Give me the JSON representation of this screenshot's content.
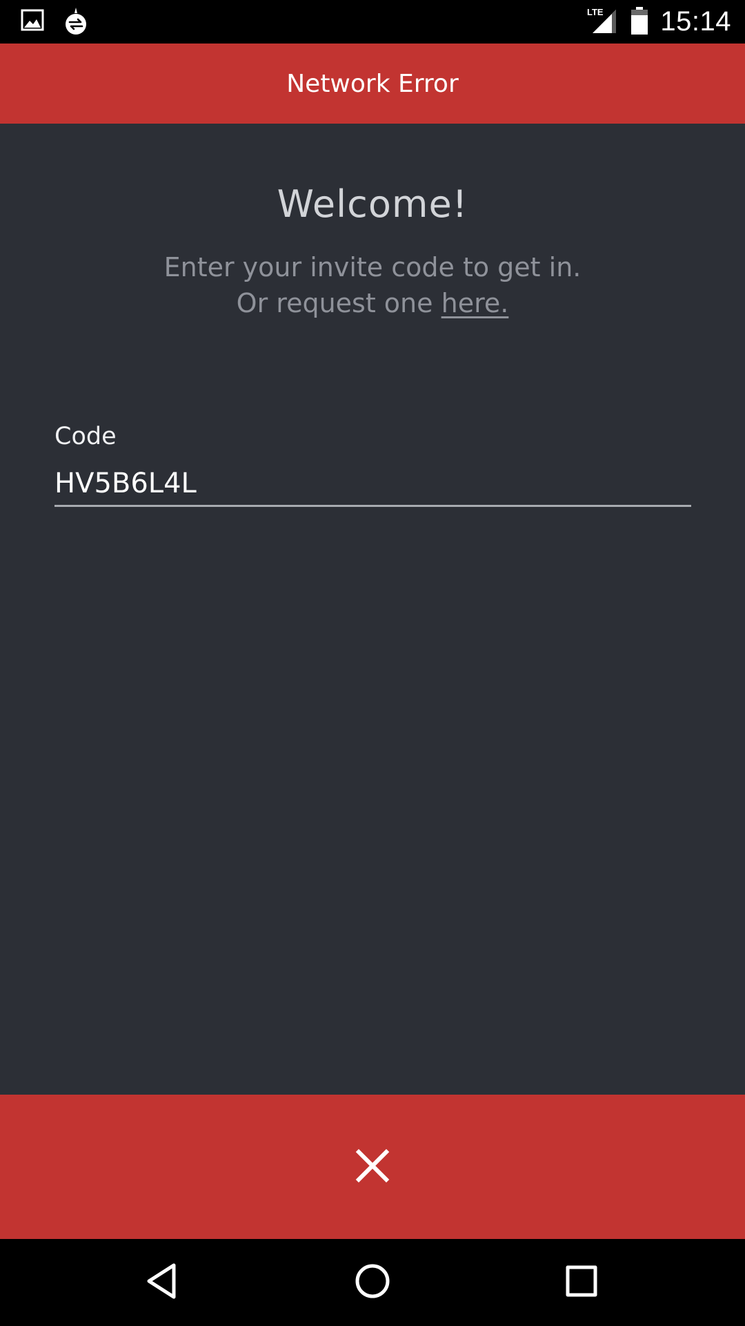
{
  "status_bar": {
    "time": "15:14",
    "network": "LTE",
    "icons": [
      "image-icon",
      "sync-icon",
      "lte-signal-icon",
      "battery-icon"
    ]
  },
  "header": {
    "title": "Network Error",
    "color": "#c23431"
  },
  "welcome": {
    "title": "Welcome!",
    "subtitle_line1": "Enter your invite code to get in.",
    "subtitle_line2_prefix": "Or request one ",
    "request_link": "here."
  },
  "code_field": {
    "label": "Code",
    "value": "HV5B6L4L"
  },
  "close_bar": {
    "icon": "close-icon",
    "color": "#c23431"
  },
  "nav_bar": {
    "icons": [
      "back-icon",
      "home-icon",
      "recents-icon"
    ]
  },
  "colors": {
    "background": "#2c2f36",
    "accent": "#c23431"
  }
}
